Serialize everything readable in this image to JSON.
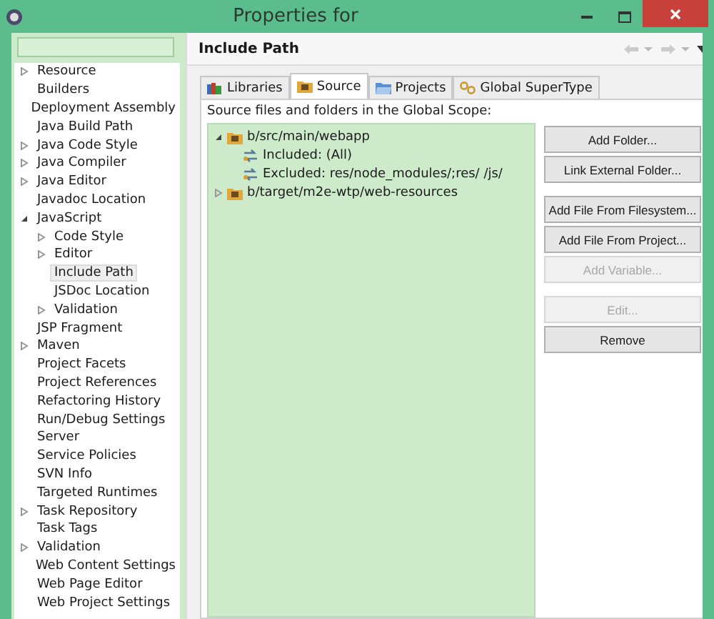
{
  "window": {
    "title": "Properties for"
  },
  "sidebar": {
    "items": [
      {
        "label": "Resource",
        "expanded": false,
        "selected": false
      },
      {
        "label": "Builders",
        "selected": false
      },
      {
        "label": "Deployment Assembly",
        "selected": false
      },
      {
        "label": "Java Build Path",
        "selected": false
      },
      {
        "label": "Java Code Style",
        "expanded": false,
        "selected": false
      },
      {
        "label": "Java Compiler",
        "expanded": false,
        "selected": false
      },
      {
        "label": "Java Editor",
        "expanded": false,
        "selected": false
      },
      {
        "label": "Javadoc Location",
        "selected": false
      },
      {
        "label": "JavaScript",
        "expanded": true,
        "selected": false,
        "children": [
          {
            "label": "Code Style",
            "expanded": false,
            "selected": false
          },
          {
            "label": "Editor",
            "expanded": false,
            "selected": false
          },
          {
            "label": "Include Path",
            "selected": true
          },
          {
            "label": "JSDoc Location",
            "selected": false
          },
          {
            "label": "Validation",
            "expanded": false,
            "selected": false
          }
        ]
      },
      {
        "label": "JSP Fragment",
        "selected": false
      },
      {
        "label": "Maven",
        "expanded": false,
        "selected": false
      },
      {
        "label": "Project Facets",
        "selected": false
      },
      {
        "label": "Project References",
        "selected": false
      },
      {
        "label": "Refactoring History",
        "selected": false
      },
      {
        "label": "Run/Debug Settings",
        "selected": false
      },
      {
        "label": "Server",
        "selected": false
      },
      {
        "label": "Service Policies",
        "selected": false
      },
      {
        "label": "SVN Info",
        "selected": false
      },
      {
        "label": "Targeted Runtimes",
        "selected": false
      },
      {
        "label": "Task Repository",
        "expanded": false,
        "selected": false
      },
      {
        "label": "Task Tags",
        "selected": false
      },
      {
        "label": "Validation",
        "expanded": false,
        "selected": false
      },
      {
        "label": "Web Content Settings",
        "selected": false
      },
      {
        "label": "Web Page Editor",
        "selected": false
      },
      {
        "label": "Web Project Settings",
        "selected": false
      }
    ]
  },
  "page": {
    "title": "Include Path",
    "tabs": [
      {
        "label": "Libraries",
        "selected": false
      },
      {
        "label": "Source",
        "selected": true
      },
      {
        "label": "Projects",
        "selected": false
      },
      {
        "label": "Global SuperType",
        "selected": false
      }
    ],
    "caption": "Source files and folders in the Global Scope:",
    "tree": [
      {
        "kind": "folder",
        "label": "b/src/main/webapp",
        "expanded": true,
        "children": [
          {
            "kind": "filter",
            "label": "Included: (All)"
          },
          {
            "kind": "filter",
            "label": "Excluded: res/node_modules/;res/ /js/"
          }
        ]
      },
      {
        "kind": "folder",
        "label": "b/target/m2e-wtp/web-resources",
        "expanded": false
      }
    ],
    "button_groups": [
      [
        {
          "label": "Add Folder...",
          "disabled": false
        },
        {
          "label": "Link External Folder...",
          "disabled": false
        }
      ],
      [
        {
          "label": "Add File From Filesystem...",
          "disabled": false
        },
        {
          "label": "Add File From Project...",
          "disabled": false
        },
        {
          "label": "Add Variable...",
          "disabled": true
        }
      ],
      [
        {
          "label": "Edit...",
          "disabled": true
        },
        {
          "label": "Remove",
          "disabled": false
        }
      ]
    ]
  }
}
